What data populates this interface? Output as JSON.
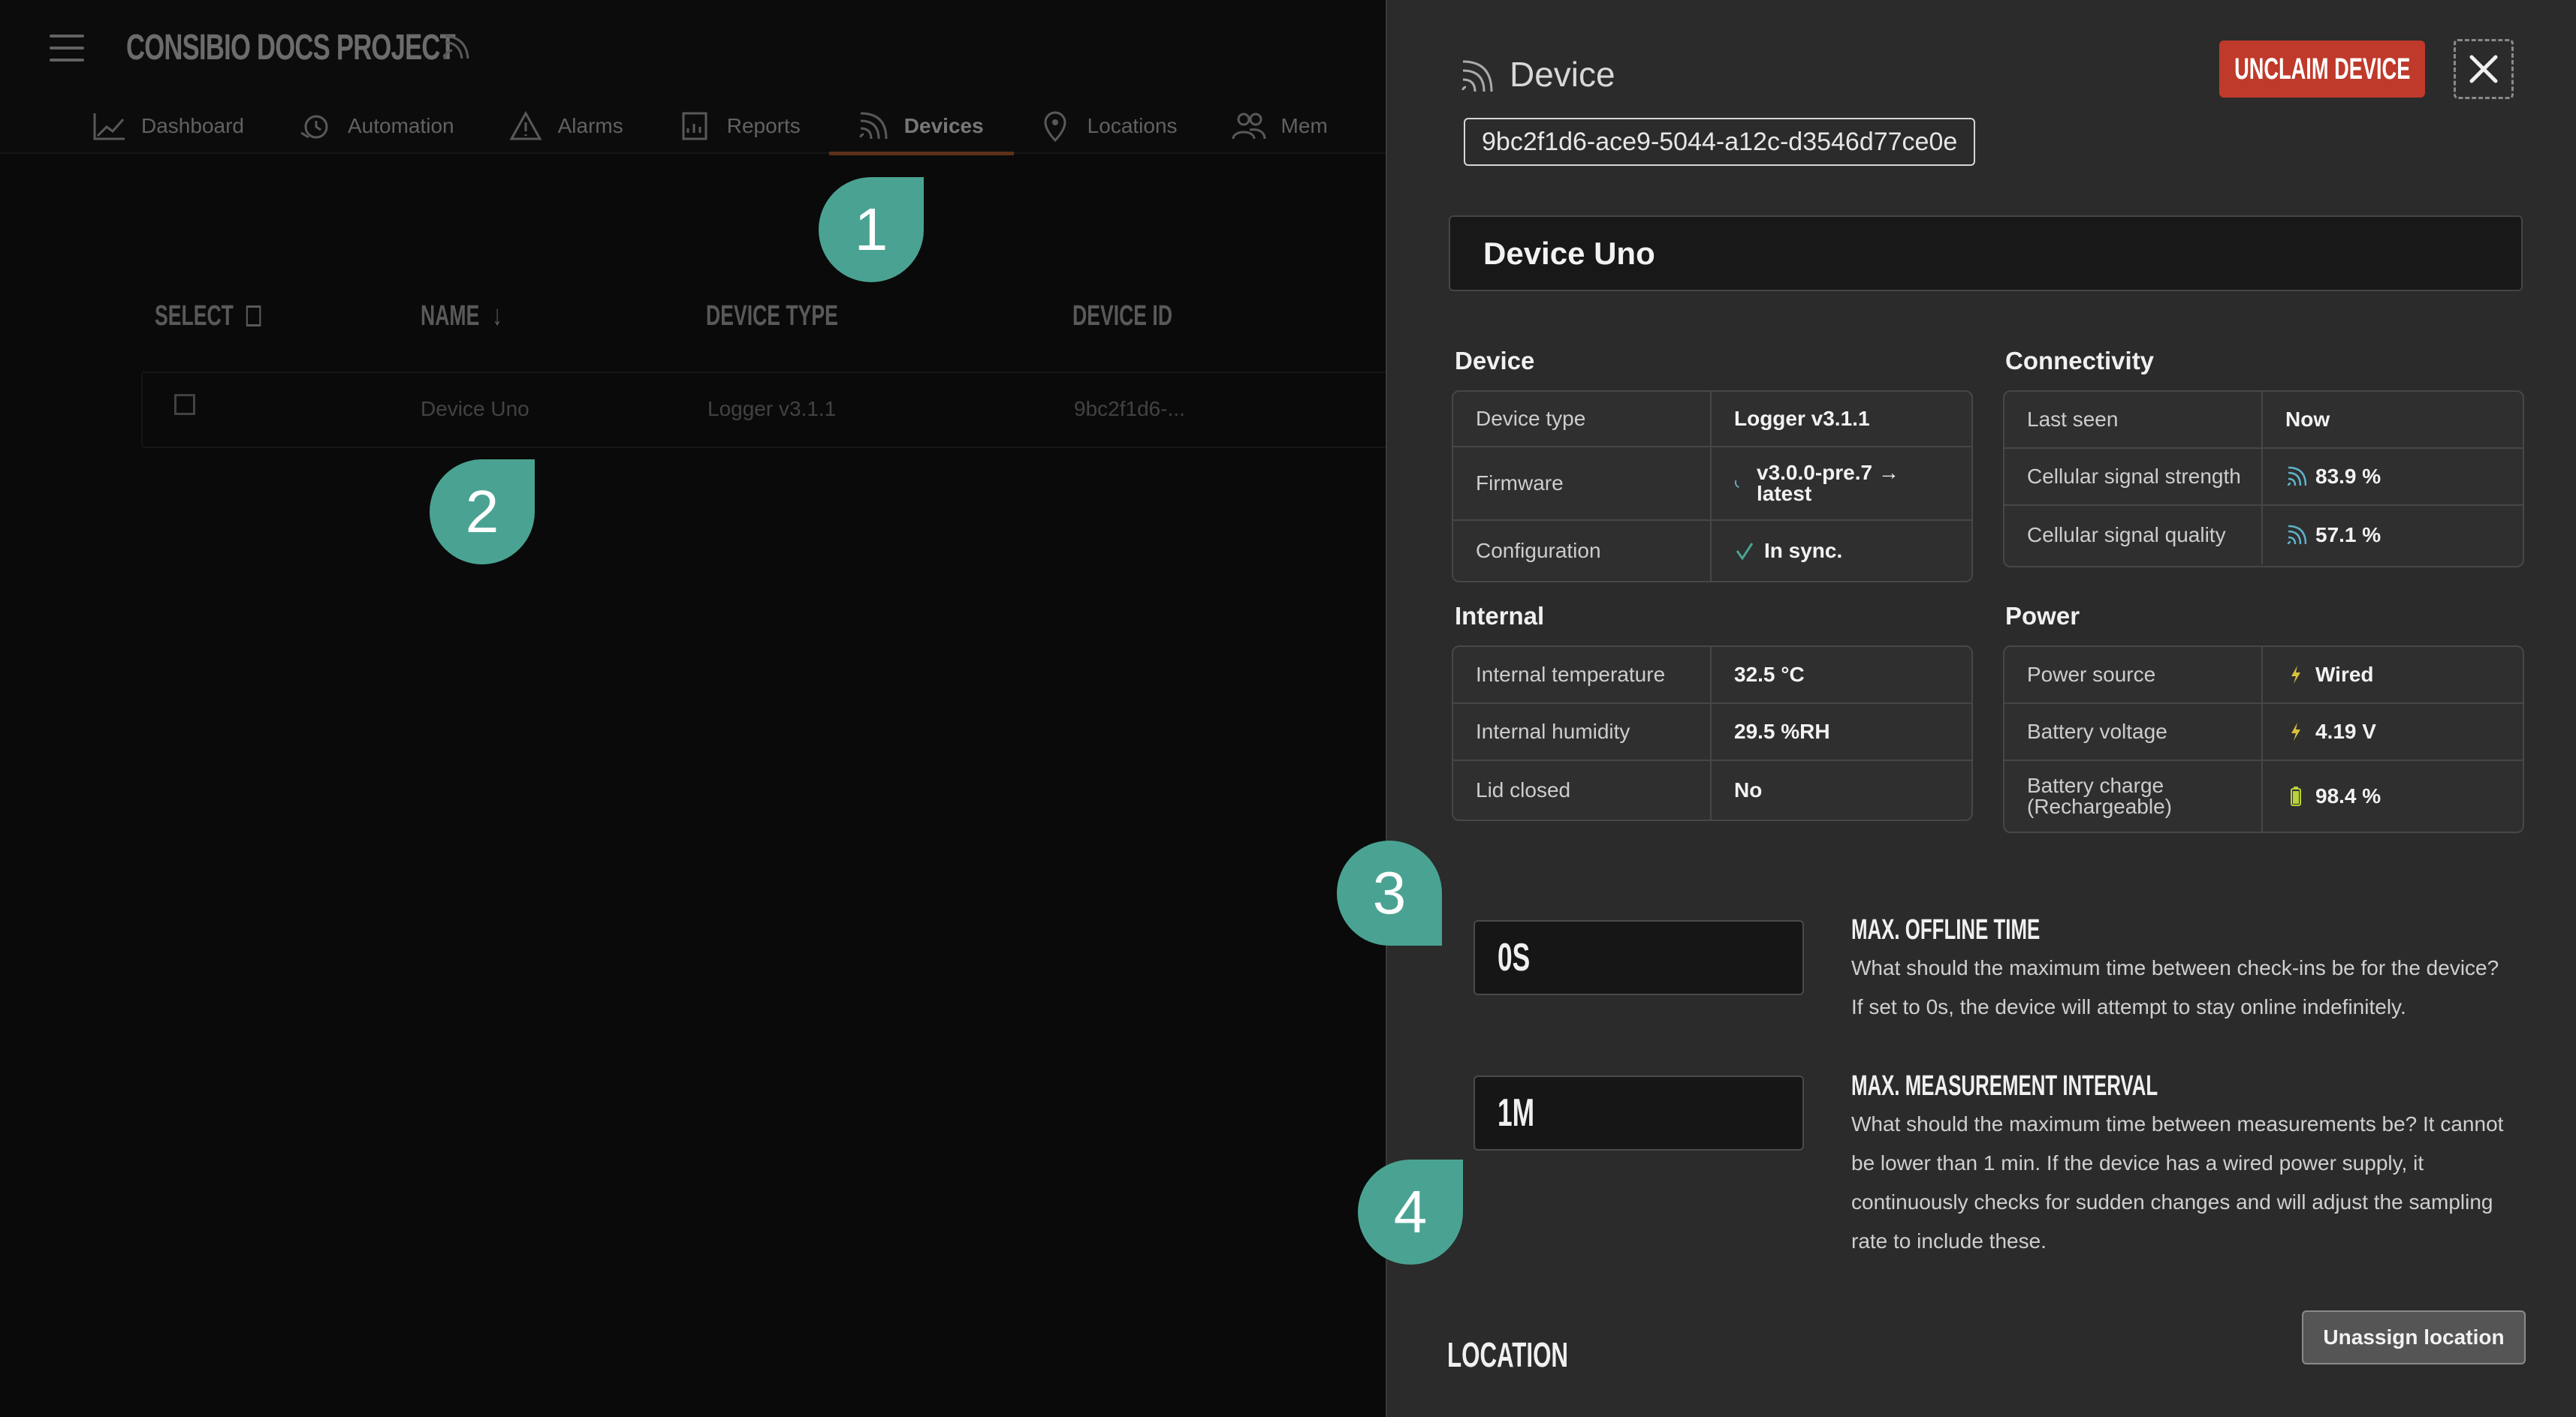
{
  "app": {
    "project_title": "CONSIBIO DOCS PROJECT",
    "nav": [
      {
        "label": "Dashboard",
        "icon": "chart-icon"
      },
      {
        "label": "Automation",
        "icon": "automation-icon"
      },
      {
        "label": "Alarms",
        "icon": "alert-icon"
      },
      {
        "label": "Reports",
        "icon": "report-icon"
      },
      {
        "label": "Devices",
        "icon": "signal-icon",
        "active": true
      },
      {
        "label": "Locations",
        "icon": "location-pin-icon"
      },
      {
        "label": "Mem",
        "icon": "members-icon"
      }
    ],
    "table": {
      "headers": {
        "select": "SELECT",
        "name": "NAME",
        "device_type": "DEVICE TYPE",
        "device_id": "DEVICE ID"
      },
      "rows": [
        {
          "name": "Device Uno",
          "device_type": "Logger v3.1.1",
          "device_id": "9bc2f1d6-..."
        }
      ]
    }
  },
  "markers": [
    "1",
    "2",
    "3",
    "4"
  ],
  "drawer": {
    "title": "Device",
    "device_id": "9bc2f1d6-ace9-5044-a12c-d3546d77ce0e",
    "unclaim_label": "UNCLAIM DEVICE",
    "device_name": "Device Uno",
    "sections": {
      "device": {
        "title": "Device",
        "rows": [
          {
            "label": "Device type",
            "value": "Logger v3.1.1"
          },
          {
            "label": "Firmware",
            "value": "v3.0.0-pre.7 → latest"
          },
          {
            "label": "Configuration",
            "value": "In sync."
          }
        ]
      },
      "connectivity": {
        "title": "Connectivity",
        "rows": [
          {
            "label": "Last seen",
            "value": "Now"
          },
          {
            "label": "Cellular signal strength",
            "value": "83.9 %"
          },
          {
            "label": "Cellular signal quality",
            "value": "57.1 %"
          }
        ]
      },
      "internal": {
        "title": "Internal",
        "rows": [
          {
            "label": "Internal temperature",
            "value": "32.5 °C"
          },
          {
            "label": "Internal humidity",
            "value": "29.5 %RH"
          },
          {
            "label": "Lid closed",
            "value": "No"
          }
        ]
      },
      "power": {
        "title": "Power",
        "rows": [
          {
            "label": "Power source",
            "value": "Wired"
          },
          {
            "label": "Battery voltage",
            "value": "4.19 V"
          },
          {
            "label": "Battery charge (Rechargeable)",
            "value": "98.4 %"
          }
        ]
      }
    },
    "settings": {
      "max_offline": {
        "value": "0S",
        "title": "MAX. OFFLINE TIME",
        "description": "What should the maximum time between check-ins be for the device? If set to 0s, the device will attempt to stay online indefinitely."
      },
      "max_interval": {
        "value": "1M",
        "title": "MAX. MEASUREMENT INTERVAL",
        "description": "What should the maximum time between measurements be? It cannot be lower than 1 min. If the device has a wired power supply, it continuously checks for sudden changes and will adjust the sampling rate to include these."
      }
    },
    "location_title": "LOCATION",
    "unassign_label": "Unassign location"
  },
  "colors": {
    "accent_teal": "#4aa392",
    "danger": "#c03a2b",
    "nav_active_underline": "#c9612d",
    "signal_icon": "#5fb3c9",
    "bolt_icon": "#d8c23a",
    "battery_icon": "#b9d23a"
  }
}
